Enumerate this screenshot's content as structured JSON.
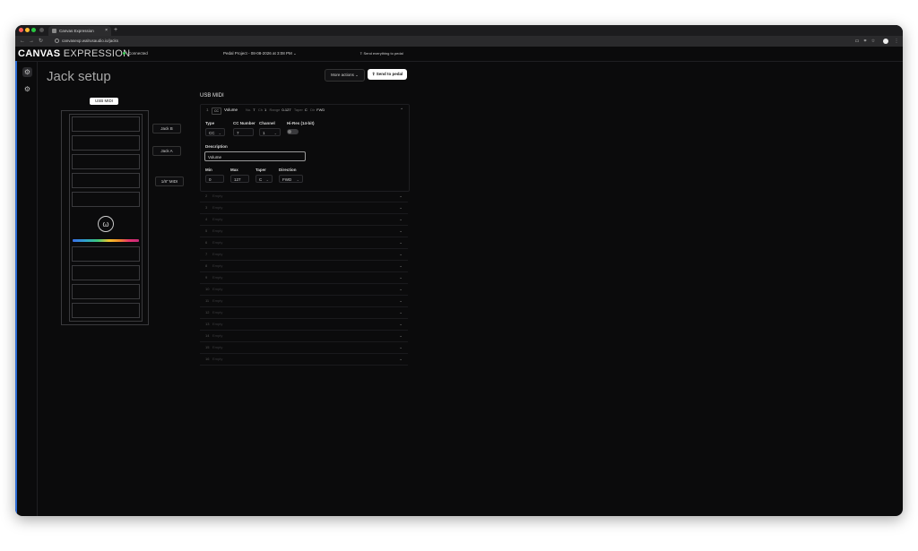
{
  "browser": {
    "tab_title": "Canvas Expression",
    "tab_close": "×",
    "new_tab": "+",
    "url": "canvasexp.walrusaudio.io/jacks"
  },
  "header": {
    "logo_bold": "CANVAS",
    "logo_light": "EXPRESSION",
    "connection_status": "Connected",
    "project": "Pedal Project - 08-08-2026 at 3:08 PM ⌄",
    "send_everything": "Send everything to pedal"
  },
  "page": {
    "title": "Jack setup",
    "more_actions": "More actions ⌄",
    "send_to_pedal": "Send to pedal"
  },
  "pedal": {
    "usb_label": "USB MIDI",
    "jacks": [
      "Jack B",
      "Jack A",
      "1/8\" MIDI"
    ]
  },
  "section": {
    "title": "USB MIDI",
    "expanded": {
      "number": "1",
      "type_badge": "CC",
      "name": "Volume",
      "meta": [
        {
          "key": "No.",
          "val": "7"
        },
        {
          "key": "Ch",
          "val": "1"
        },
        {
          "key": "Range",
          "val": "0-127"
        },
        {
          "key": "Taper",
          "val": "C"
        },
        {
          "key": "Dir",
          "val": "FWD"
        }
      ],
      "labels": {
        "type": "Type",
        "cc_number": "CC Number",
        "channel": "Channel",
        "hires": "Hi-Res (14-bit)",
        "description": "Description",
        "min": "Min",
        "max": "Max",
        "taper": "Taper",
        "direction": "Direction"
      },
      "values": {
        "type": "CC",
        "cc_number": "7",
        "channel": "1",
        "description": "Volume",
        "min": "0",
        "max": "127",
        "taper": "C",
        "direction": "FWD"
      },
      "hires_on": false
    },
    "empty_label": "Empty",
    "rows": [
      "2",
      "3",
      "4",
      "5",
      "6",
      "7",
      "8",
      "9",
      "10",
      "11",
      "12",
      "13",
      "14",
      "15",
      "16"
    ]
  }
}
